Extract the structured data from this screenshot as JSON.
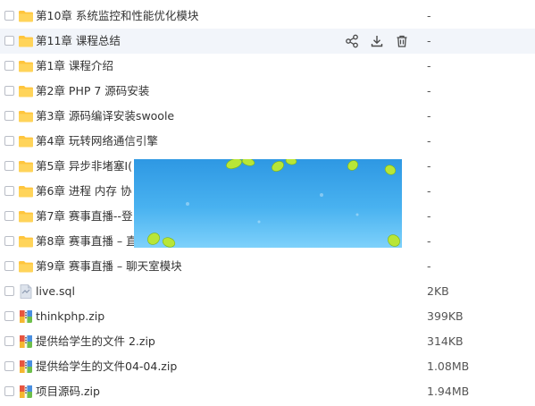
{
  "files": [
    {
      "name": "第10章 系统监控和性能优化模块",
      "size": "-",
      "type": "folder"
    },
    {
      "name": "第11章 课程总结",
      "size": "-",
      "type": "folder",
      "hover": true
    },
    {
      "name": "第1章 课程介绍",
      "size": "-",
      "type": "folder"
    },
    {
      "name": "第2章 PHP 7 源码安装",
      "size": "-",
      "type": "folder"
    },
    {
      "name": "第3章 源码编译安装swoole",
      "size": "-",
      "type": "folder"
    },
    {
      "name": "第4章 玩转网络通信引擎",
      "size": "-",
      "type": "folder"
    },
    {
      "name": "第5章 异步非堵塞I(",
      "size": "-",
      "type": "folder"
    },
    {
      "name": "第6章 进程 内存 协",
      "size": "-",
      "type": "folder"
    },
    {
      "name": "第7章 赛事直播--登",
      "size": "-",
      "type": "folder"
    },
    {
      "name": "第8章 赛事直播 – 直",
      "size": "-",
      "type": "folder"
    },
    {
      "name": "第9章 赛事直播 – 聊天室模块",
      "size": "-",
      "type": "folder"
    },
    {
      "name": "live.sql",
      "size": "2KB",
      "type": "sql"
    },
    {
      "name": "thinkphp.zip",
      "size": "399KB",
      "type": "zip"
    },
    {
      "name": "提供给学生的文件 2.zip",
      "size": "314KB",
      "type": "zip"
    },
    {
      "name": "提供给学生的文件04-04.zip",
      "size": "1.08MB",
      "type": "zip"
    },
    {
      "name": "项目源码.zip",
      "size": "1.94MB",
      "type": "zip"
    }
  ],
  "row_actions": [
    {
      "icon": "share-icon"
    },
    {
      "icon": "download-icon"
    },
    {
      "icon": "delete-icon"
    }
  ],
  "colors": {
    "folder": "#ffc53d",
    "hover_row": "#f2f5fa",
    "accent": "#2e98e3"
  }
}
